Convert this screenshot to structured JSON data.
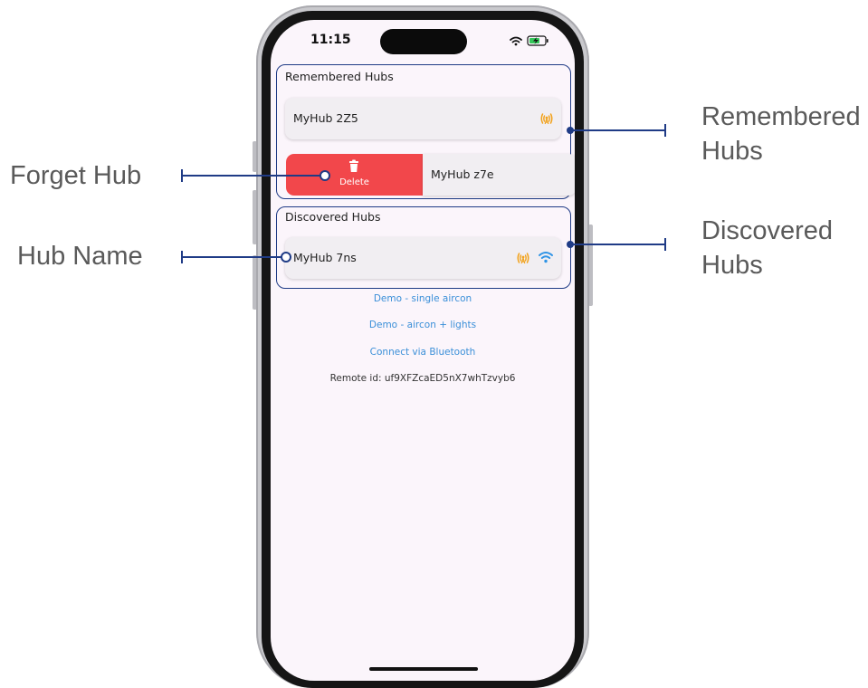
{
  "status_bar": {
    "time": "11:15"
  },
  "remembered": {
    "title": "Remembered Hubs",
    "hubs": [
      {
        "name": "MyHub 2Z5",
        "icons": [
          "broadcast-icon"
        ]
      },
      {
        "name": "MyHub z7e",
        "swipe_action": "Delete"
      }
    ]
  },
  "discovered": {
    "title": "Discovered Hubs",
    "hubs": [
      {
        "name": "MyHub 7ns",
        "icons": [
          "broadcast-icon",
          "wifi-icon"
        ]
      }
    ]
  },
  "links": [
    "Demo - single aircon",
    "Demo - aircon + lights",
    "Connect via Bluetooth"
  ],
  "remote_id": "Remote id: uf9XFZcaED5nX7whTzvyb6",
  "annotations": {
    "forget_hub": "Forget Hub",
    "hub_name": "Hub Name",
    "remembered_line1": "Remembered",
    "remembered_line2": "Hubs",
    "discovered_line1": "Discovered",
    "discovered_line2": "Hubs"
  },
  "colors": {
    "frame": "#1f3b86",
    "delete": "#f2474b",
    "link": "#3a8fd8",
    "broadcast": "#f2a21b",
    "wifi": "#2e93e6"
  }
}
